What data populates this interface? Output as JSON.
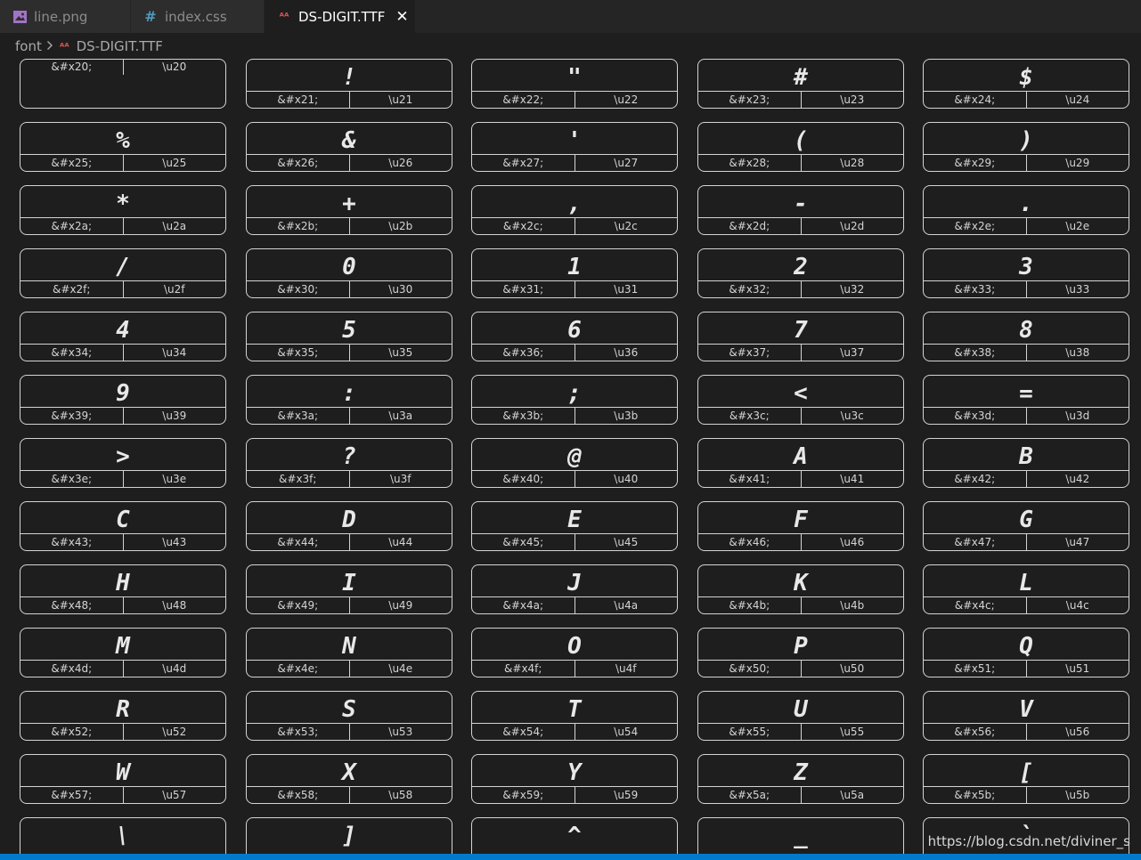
{
  "tabs": [
    {
      "label": "line.png",
      "icon": "image-icon",
      "active": false
    },
    {
      "label": "index.css",
      "icon": "hash-icon",
      "active": false
    },
    {
      "label": "DS-DIGIT.TTF",
      "icon": "font-file-icon",
      "active": true
    }
  ],
  "close_glyph": "✕",
  "breadcrumb": {
    "folder": "font",
    "file": "DS-DIGIT.TTF"
  },
  "glyphs": [
    {
      "char": "",
      "html": "&#x20;",
      "unicode": "\\u20"
    },
    {
      "char": "!",
      "html": "&#x21;",
      "unicode": "\\u21"
    },
    {
      "char": "\"",
      "html": "&#x22;",
      "unicode": "\\u22"
    },
    {
      "char": "#",
      "html": "&#x23;",
      "unicode": "\\u23"
    },
    {
      "char": "$",
      "html": "&#x24;",
      "unicode": "\\u24"
    },
    {
      "char": "%",
      "html": "&#x25;",
      "unicode": "\\u25"
    },
    {
      "char": "&",
      "html": "&#x26;",
      "unicode": "\\u26"
    },
    {
      "char": "'",
      "html": "&#x27;",
      "unicode": "\\u27"
    },
    {
      "char": "(",
      "html": "&#x28;",
      "unicode": "\\u28"
    },
    {
      "char": ")",
      "html": "&#x29;",
      "unicode": "\\u29"
    },
    {
      "char": "*",
      "html": "&#x2a;",
      "unicode": "\\u2a"
    },
    {
      "char": "+",
      "html": "&#x2b;",
      "unicode": "\\u2b"
    },
    {
      "char": ",",
      "html": "&#x2c;",
      "unicode": "\\u2c"
    },
    {
      "char": "-",
      "html": "&#x2d;",
      "unicode": "\\u2d"
    },
    {
      "char": ".",
      "html": "&#x2e;",
      "unicode": "\\u2e"
    },
    {
      "char": "/",
      "html": "&#x2f;",
      "unicode": "\\u2f"
    },
    {
      "char": "0",
      "html": "&#x30;",
      "unicode": "\\u30"
    },
    {
      "char": "1",
      "html": "&#x31;",
      "unicode": "\\u31"
    },
    {
      "char": "2",
      "html": "&#x32;",
      "unicode": "\\u32"
    },
    {
      "char": "3",
      "html": "&#x33;",
      "unicode": "\\u33"
    },
    {
      "char": "4",
      "html": "&#x34;",
      "unicode": "\\u34"
    },
    {
      "char": "5",
      "html": "&#x35;",
      "unicode": "\\u35"
    },
    {
      "char": "6",
      "html": "&#x36;",
      "unicode": "\\u36"
    },
    {
      "char": "7",
      "html": "&#x37;",
      "unicode": "\\u37"
    },
    {
      "char": "8",
      "html": "&#x38;",
      "unicode": "\\u38"
    },
    {
      "char": "9",
      "html": "&#x39;",
      "unicode": "\\u39"
    },
    {
      "char": ":",
      "html": "&#x3a;",
      "unicode": "\\u3a"
    },
    {
      "char": ";",
      "html": "&#x3b;",
      "unicode": "\\u3b"
    },
    {
      "char": "<",
      "html": "&#x3c;",
      "unicode": "\\u3c"
    },
    {
      "char": "=",
      "html": "&#x3d;",
      "unicode": "\\u3d"
    },
    {
      "char": ">",
      "html": "&#x3e;",
      "unicode": "\\u3e"
    },
    {
      "char": "?",
      "html": "&#x3f;",
      "unicode": "\\u3f"
    },
    {
      "char": "@",
      "html": "&#x40;",
      "unicode": "\\u40"
    },
    {
      "char": "A",
      "html": "&#x41;",
      "unicode": "\\u41"
    },
    {
      "char": "B",
      "html": "&#x42;",
      "unicode": "\\u42"
    },
    {
      "char": "C",
      "html": "&#x43;",
      "unicode": "\\u43"
    },
    {
      "char": "D",
      "html": "&#x44;",
      "unicode": "\\u44"
    },
    {
      "char": "E",
      "html": "&#x45;",
      "unicode": "\\u45"
    },
    {
      "char": "F",
      "html": "&#x46;",
      "unicode": "\\u46"
    },
    {
      "char": "G",
      "html": "&#x47;",
      "unicode": "\\u47"
    },
    {
      "char": "H",
      "html": "&#x48;",
      "unicode": "\\u48"
    },
    {
      "char": "I",
      "html": "&#x49;",
      "unicode": "\\u49"
    },
    {
      "char": "J",
      "html": "&#x4a;",
      "unicode": "\\u4a"
    },
    {
      "char": "K",
      "html": "&#x4b;",
      "unicode": "\\u4b"
    },
    {
      "char": "L",
      "html": "&#x4c;",
      "unicode": "\\u4c"
    },
    {
      "char": "M",
      "html": "&#x4d;",
      "unicode": "\\u4d"
    },
    {
      "char": "N",
      "html": "&#x4e;",
      "unicode": "\\u4e"
    },
    {
      "char": "O",
      "html": "&#x4f;",
      "unicode": "\\u4f"
    },
    {
      "char": "P",
      "html": "&#x50;",
      "unicode": "\\u50"
    },
    {
      "char": "Q",
      "html": "&#x51;",
      "unicode": "\\u51"
    },
    {
      "char": "R",
      "html": "&#x52;",
      "unicode": "\\u52"
    },
    {
      "char": "S",
      "html": "&#x53;",
      "unicode": "\\u53"
    },
    {
      "char": "T",
      "html": "&#x54;",
      "unicode": "\\u54"
    },
    {
      "char": "U",
      "html": "&#x55;",
      "unicode": "\\u55"
    },
    {
      "char": "V",
      "html": "&#x56;",
      "unicode": "\\u56"
    },
    {
      "char": "W",
      "html": "&#x57;",
      "unicode": "\\u57"
    },
    {
      "char": "X",
      "html": "&#x58;",
      "unicode": "\\u58"
    },
    {
      "char": "Y",
      "html": "&#x59;",
      "unicode": "\\u59"
    },
    {
      "char": "Z",
      "html": "&#x5a;",
      "unicode": "\\u5a"
    },
    {
      "char": "[",
      "html": "&#x5b;",
      "unicode": "\\u5b"
    },
    {
      "char": "\\",
      "html": "",
      "unicode": ""
    },
    {
      "char": "]",
      "html": "",
      "unicode": ""
    },
    {
      "char": "^",
      "html": "",
      "unicode": ""
    },
    {
      "char": "_",
      "html": "",
      "unicode": ""
    },
    {
      "char": "`",
      "html": "",
      "unicode": ""
    }
  ],
  "watermark": "https://blog.csdn.net/diviner_s",
  "colors": {
    "editor_bg": "#1e1e1e",
    "tab_bg": "#2d2d2d",
    "border": "#d4d4d4",
    "status_bar": "#007acc",
    "font_icon": "#e05252",
    "css_icon": "#519aba"
  }
}
